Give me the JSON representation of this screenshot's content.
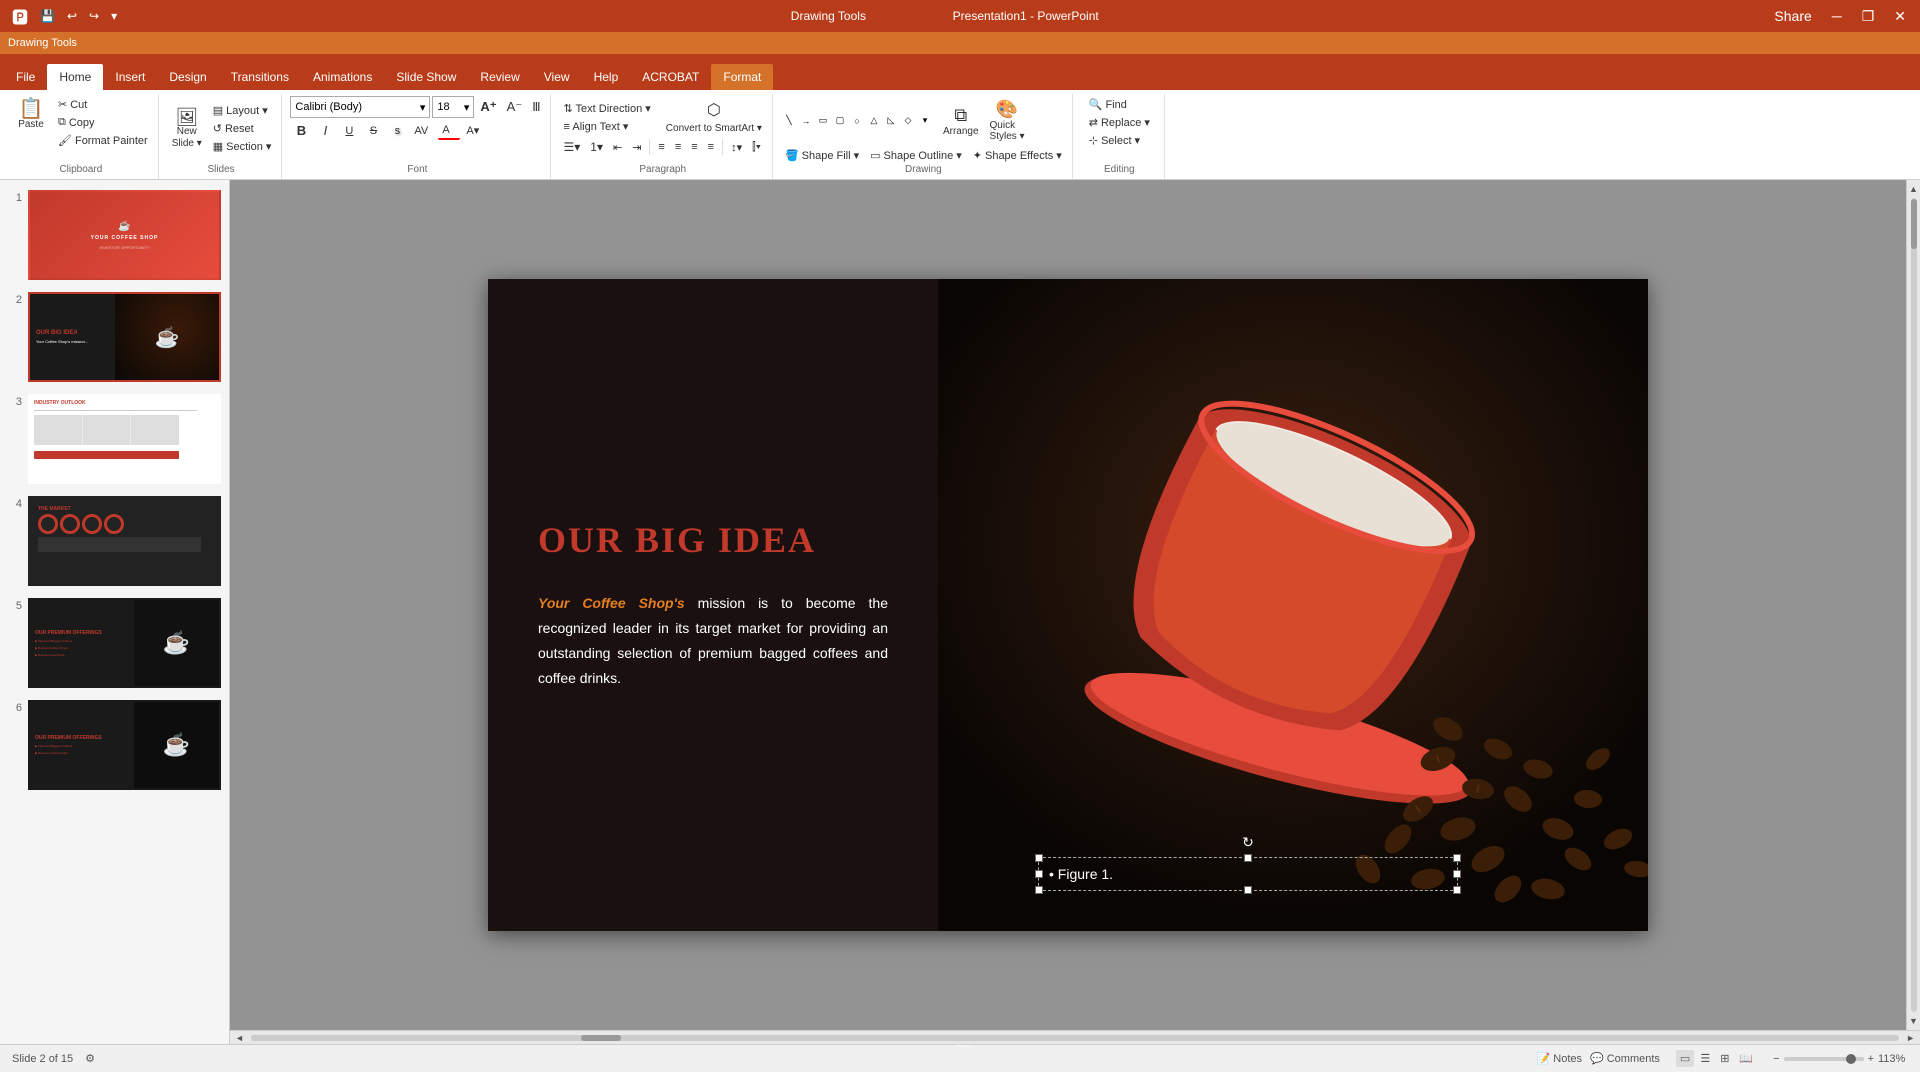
{
  "titlebar": {
    "app_name": "Presentation1 - PowerPoint",
    "drawing_tools": "Drawing Tools",
    "quick_access": [
      "save",
      "undo",
      "redo",
      "customize"
    ],
    "window_controls": [
      "minimize",
      "restore",
      "close"
    ]
  },
  "ribbon": {
    "tabs": [
      {
        "id": "file",
        "label": "File"
      },
      {
        "id": "home",
        "label": "Home",
        "active": true
      },
      {
        "id": "insert",
        "label": "Insert"
      },
      {
        "id": "design",
        "label": "Design"
      },
      {
        "id": "transitions",
        "label": "Transitions"
      },
      {
        "id": "animations",
        "label": "Animations"
      },
      {
        "id": "slideshow",
        "label": "Slide Show"
      },
      {
        "id": "review",
        "label": "Review"
      },
      {
        "id": "view",
        "label": "View"
      },
      {
        "id": "help",
        "label": "Help"
      },
      {
        "id": "acrobat",
        "label": "ACROBAT"
      },
      {
        "id": "format",
        "label": "Format",
        "contextual": true
      }
    ],
    "groups": {
      "clipboard": {
        "label": "Clipboard",
        "paste_label": "Paste",
        "cut_label": "Cut",
        "copy_label": "Copy",
        "format_painter_label": "Format Painter"
      },
      "slides": {
        "label": "Slides",
        "new_slide_label": "New\nSlide",
        "layout_label": "Layout",
        "reset_label": "Reset",
        "section_label": "Section"
      },
      "font": {
        "label": "Font",
        "font_name": "Calibri (Body)",
        "font_size": "18",
        "bold": "B",
        "italic": "I",
        "underline": "U",
        "strikethrough": "S",
        "shadow": "s",
        "char_spacing_label": "AV",
        "font_color_label": "A",
        "highlight_label": "A"
      },
      "paragraph": {
        "label": "Paragraph",
        "bullets_label": "Bullets",
        "numbering_label": "Numbering",
        "decrease_indent_label": "Decrease Indent",
        "increase_indent_label": "Increase Indent",
        "left_align": "Left",
        "center_align": "Center",
        "right_align": "Right",
        "justify_align": "Justify",
        "line_spacing": "Line Spacing",
        "columns_label": "Columns"
      },
      "text_direction_label": "Text Direction",
      "align_text_label": "Align Text",
      "convert_smartart_label": "Convert to SmartArt",
      "drawing": {
        "label": "Drawing",
        "arrange_label": "Arrange",
        "quick_styles_label": "Quick\nStyles",
        "shape_fill_label": "Shape Fill",
        "shape_outline_label": "Shape Outline",
        "shape_effects_label": "Shape Effects"
      },
      "editing": {
        "label": "Editing",
        "find_label": "Find",
        "replace_label": "Replace",
        "select_label": "Select"
      }
    }
  },
  "slide_panel": {
    "slides": [
      {
        "num": "1",
        "type": "title"
      },
      {
        "num": "2",
        "type": "bigidea",
        "selected": true
      },
      {
        "num": "3",
        "type": "industry"
      },
      {
        "num": "4",
        "type": "market"
      },
      {
        "num": "5",
        "type": "offerings"
      },
      {
        "num": "6",
        "type": "offerings2"
      }
    ]
  },
  "slide2": {
    "title": "OUR BIG IDEA",
    "highlight": "Your Coffee Shop's",
    "body_text": " mission is to become the recognized leader in its target market for providing an outstanding selection of premium bagged coffees and coffee drinks.",
    "figure_caption": "Figure 1."
  },
  "status_bar": {
    "slide_info": "Slide 2 of 15",
    "notes_label": "Notes",
    "comments_label": "Comments",
    "zoom_label": "113%",
    "view_icons": [
      "normal",
      "outline",
      "slide_sorter",
      "reading"
    ]
  }
}
